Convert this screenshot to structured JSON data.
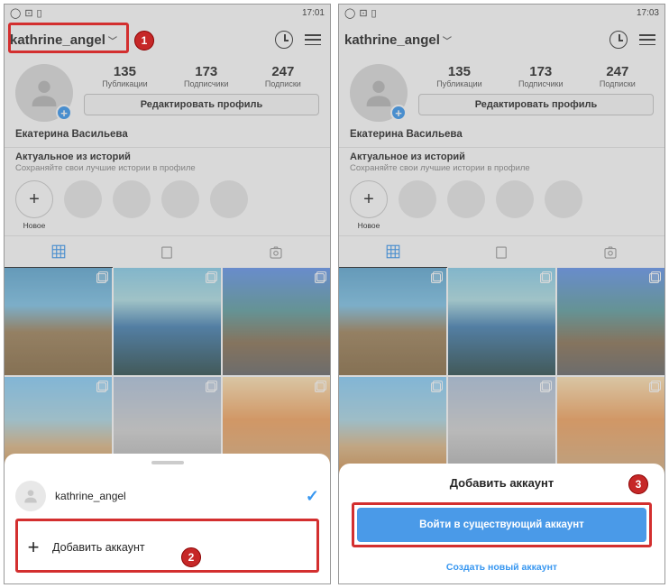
{
  "left": {
    "status_time": "17:01",
    "username": "kathrine_angel",
    "stats": {
      "posts": "135",
      "posts_lbl": "Публикации",
      "followers": "173",
      "followers_lbl": "Подписчики",
      "following": "247",
      "following_lbl": "Подписки"
    },
    "edit_profile": "Редактировать профиль",
    "display_name": "Екатерина Васильева",
    "highlights_title": "Актуальное из историй",
    "highlights_sub": "Сохраняйте свои лучшие истории в профиле",
    "highlight_new": "Новое",
    "sheet": {
      "account": "kathrine_angel",
      "add": "Добавить аккаунт"
    }
  },
  "right": {
    "status_time": "17:03",
    "username": "kathrine_angel",
    "stats": {
      "posts": "135",
      "posts_lbl": "Публикации",
      "followers": "173",
      "followers_lbl": "Подписчики",
      "following": "247",
      "following_lbl": "Подписки"
    },
    "edit_profile": "Редактировать профиль",
    "display_name": "Екатерина Васильева",
    "highlights_title": "Актуальное из историй",
    "highlights_sub": "Сохраняйте свои лучшие истории в профиле",
    "highlight_new": "Новое",
    "sheet": {
      "title": "Добавить аккаунт",
      "login": "Войти в существующий аккаунт",
      "create": "Создать новый аккаунт"
    }
  },
  "badges": {
    "one": "1",
    "two": "2",
    "three": "3"
  }
}
